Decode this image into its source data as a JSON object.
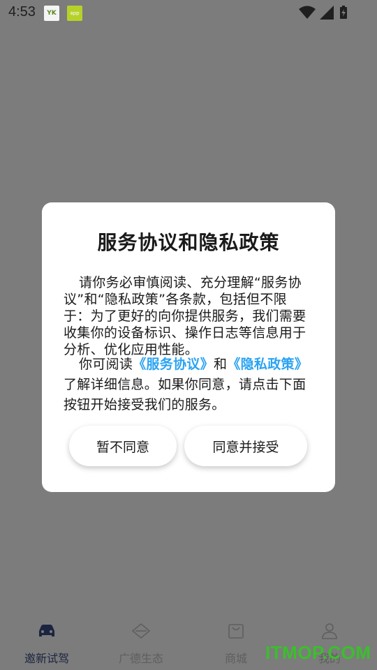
{
  "status_bar": {
    "time": "4:53",
    "app_icon_1": "YK",
    "app_icon_2": "app",
    "icons": [
      "wifi-icon",
      "signal-icon",
      "battery-icon"
    ]
  },
  "dialog": {
    "title": "服务协议和隐私政策",
    "paragraph1": "请你务必审慎阅读、充分理解“服务协议”和“隐私政策”各条款，包括但不限于：为了更好的向你提供服务，我们需要收集你的设备标识、操作日志等信息用于分析、优化应用性能。",
    "paragraph2_prefix": "你可阅读",
    "service_link": "《服务协议》",
    "and_text": "和",
    "privacy_link": "《隐私政策》",
    "paragraph2_suffix": "了解详细信息。如果你同意，请点击下面按钮开始接受我们的服务。",
    "decline_label": "暂不同意",
    "accept_label": "同意并接受"
  },
  "tabs": [
    {
      "label": "邀新试驾",
      "icon": "car-icon",
      "active": true
    },
    {
      "label": "广德生态",
      "icon": "ecology-icon",
      "active": false
    },
    {
      "label": "商城",
      "icon": "shop-bag-icon",
      "active": false
    },
    {
      "label": "我的",
      "icon": "user-icon",
      "active": false
    }
  ],
  "watermark": "ITMOP.COM",
  "colors": {
    "overlay": "#7c7c7c",
    "link": "#2aa3f2",
    "active_tab": "#1c2540",
    "watermark": "#3bbf2c"
  }
}
